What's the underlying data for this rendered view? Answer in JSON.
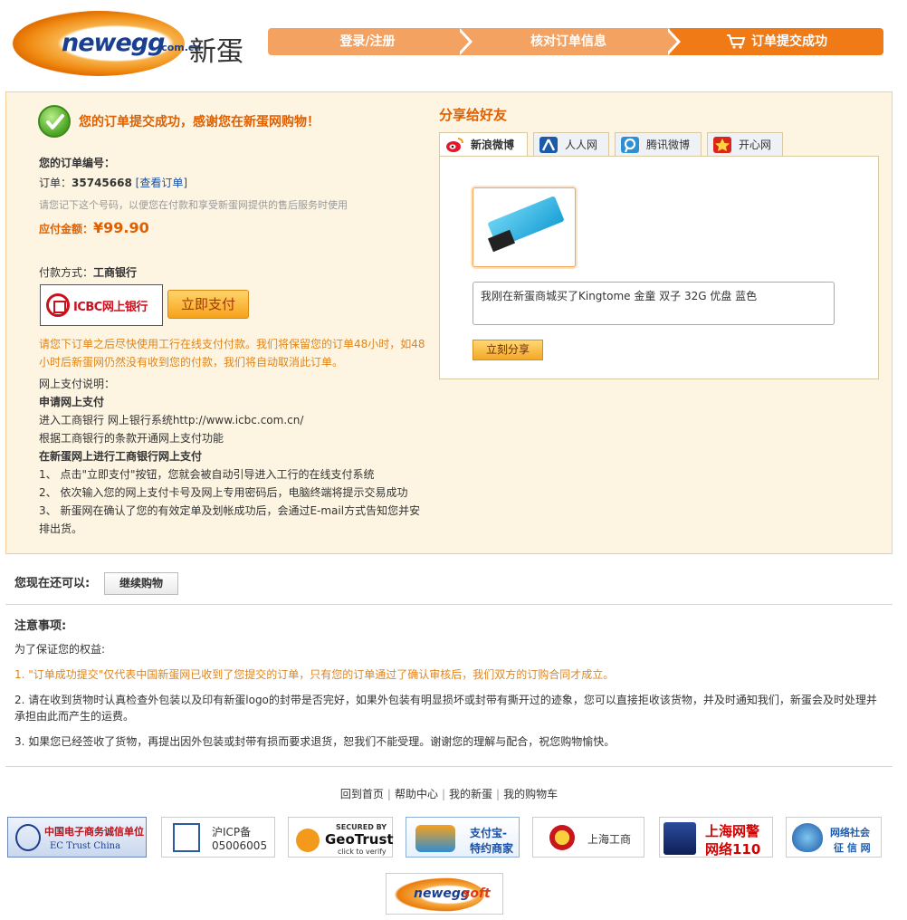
{
  "brand": {
    "logo_word": "newegg",
    "logo_domain": ".com.cn",
    "logo_cn": "新蛋"
  },
  "steps": [
    "登录/注册",
    "核对订单信息",
    "订单提交成功"
  ],
  "success": {
    "message": "您的订单提交成功，感谢您在新蛋网购物！",
    "order_no_title": "您的订单编号：",
    "order_label": "订单：",
    "order_number": "35745668",
    "view_order_link": "[查看订单]",
    "remember_hint": "请您记下这个号码，以便您在付款和享受新蛋网提供的售后服务时使用",
    "amount_label": "应付金额：",
    "amount_value": "¥99.90",
    "pay_method_label": "付款方式：",
    "pay_method_value": "工商银行",
    "bank_logo_text": "ICBC网上银行",
    "pay_now_button": "立即支付",
    "warning": "请您下订单之后尽快使用工行在线支付付款。我们将保留您的订单48小时，如48小时后新蛋网仍然没有收到您的付款，我们将自动取消此订单。"
  },
  "pay_notes": {
    "title": "网上支付说明：",
    "h1": "申请网上支付",
    "l1": "进入工商银行 网上银行系统http://www.icbc.com.cn/",
    "l2": "根据工商银行的条款开通网上支付功能",
    "h2": "在新蛋网上进行工商银行网上支付",
    "s1": "1、 点击\"立即支付\"按钮，您就会被自动引导进入工行的在线支付系统",
    "s2": "2、 依次输入您的网上支付卡号及网上专用密码后，电脑终端将提示交易成功",
    "s3": "3、 新蛋网在确认了您的有效定单及划帐成功后，会通过E-mail方式告知您并安排出货。"
  },
  "share": {
    "title": "分享给好友",
    "tabs": [
      "新浪微博",
      "人人网",
      "腾讯微博",
      "开心网"
    ],
    "text": "我刚在新蛋商城买了Kingtome 金童 双子 32G 优盘 蓝色",
    "button": "立刻分享"
  },
  "continue": {
    "label": "您现在还可以:",
    "button": "继续购物"
  },
  "notes": {
    "title": "注意事项:",
    "intro": "为了保证您的权益:",
    "n1": "1. \"订单成功提交\"仅代表中国新蛋网已收到了您提交的订单，只有您的订单通过了确认审核后，我们双方的订购合同才成立。",
    "n2": "2. 请在收到货物时认真检查外包装以及印有新蛋logo的封带是否完好，如果外包装有明显损坏或封带有撕开过的迹象，您可以直接拒收该货物，并及时通知我们，新蛋会及时处理并承担由此而产生的运费。",
    "n3": "3. 如果您已经签收了货物，再提出因外包装或封带有损而要求退货，恕我们不能受理。谢谢您的理解与配合，祝您购物愉快。"
  },
  "footer": {
    "links": [
      "回到首页",
      "帮助中心",
      "我的新蛋",
      "我的购物车"
    ],
    "badges": {
      "ec_trust_cn": "中国电子商务诚信单位",
      "ec_trust_en": "EC Trust China",
      "icp_l1": "沪ICP备",
      "icp_l2": "05006005",
      "geotrust_secured": "SECURED BY",
      "geotrust_name": "GeoTrust",
      "geotrust_verify": "click to verify",
      "alipay_l1": "支付宝-",
      "alipay_l2": "特约商家",
      "sh_gongshang": "上海工商",
      "police_l1": "上海网警",
      "police_l2": "网络110",
      "credit_l1": "网络社会",
      "credit_l2": "征 信 网"
    },
    "soft_logo_a": "newegg",
    "soft_logo_b": "soft"
  }
}
